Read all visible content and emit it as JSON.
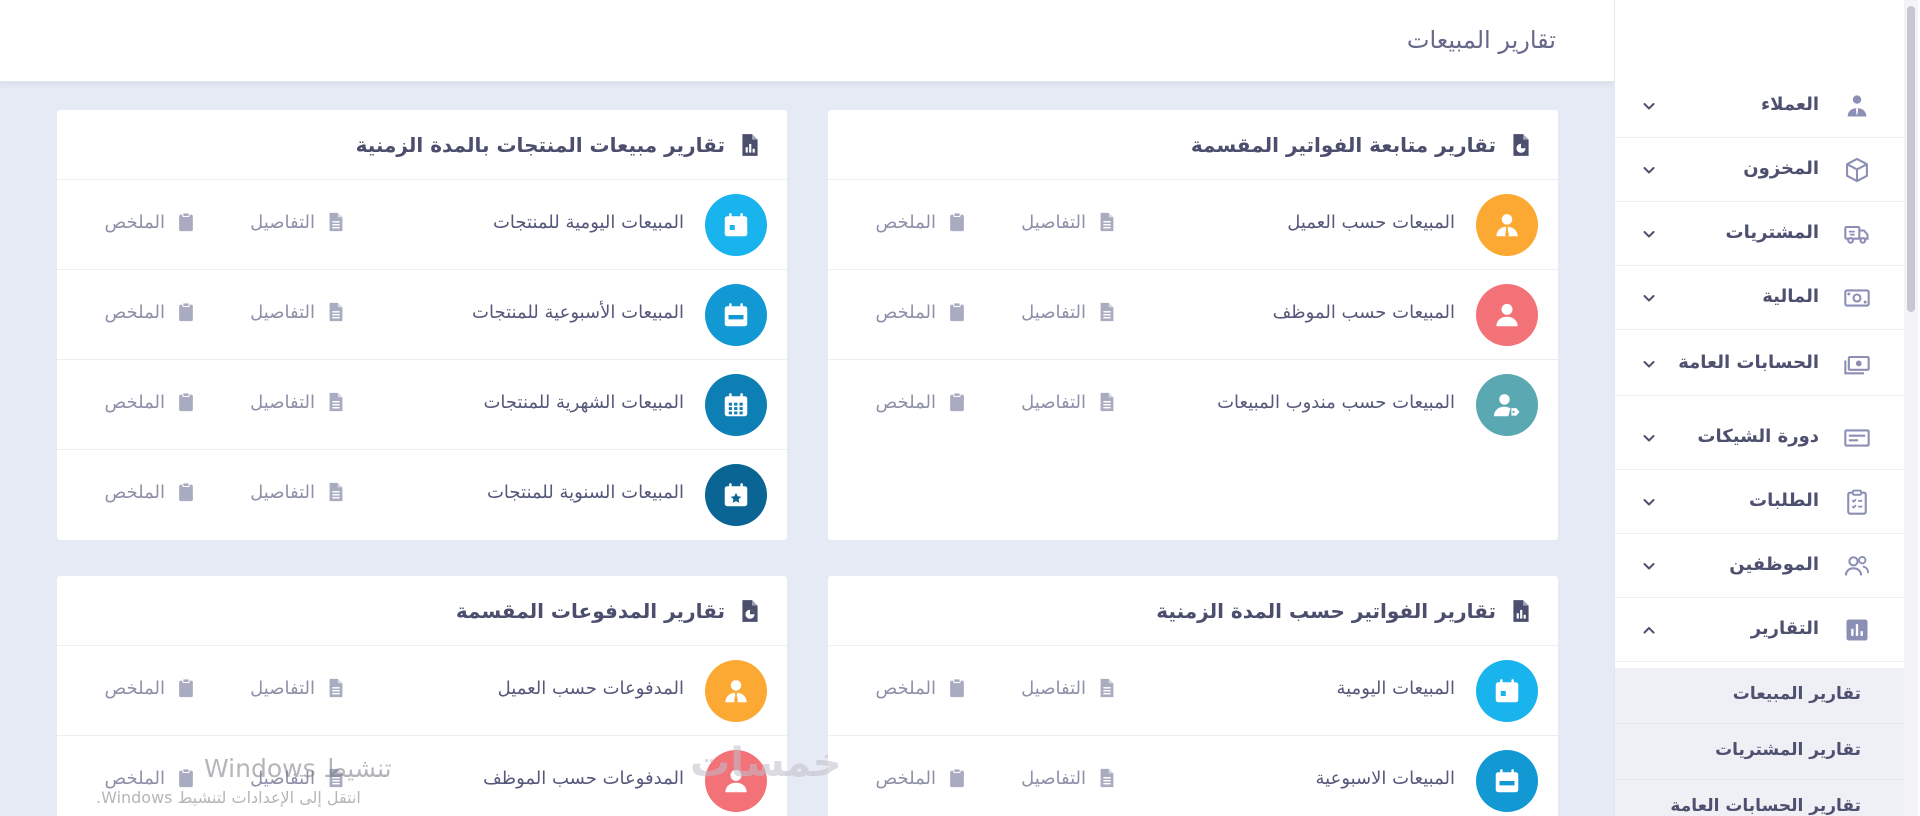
{
  "page_title": "تقارير المبيعات",
  "cards": [
    {
      "title": "تقارير متابعة الفواتير المقسمة",
      "header_icon": "file-pie-icon",
      "rows": [
        {
          "label": "المبيعات حسب العميل",
          "icon": "user-tie-icon",
          "color": "#fba933"
        },
        {
          "label": "المبيعات حسب الموظف",
          "icon": "user-icon",
          "color": "#f37278"
        },
        {
          "label": "المبيعات حسب مندوب المبيعات",
          "icon": "user-tag-icon",
          "color": "#5aa8b2"
        }
      ]
    },
    {
      "title": "تقارير مبيعات المنتجات بالمدة الزمنية",
      "header_icon": "file-chart-icon",
      "rows": [
        {
          "label": "المبيعات اليومية للمنتجات",
          "icon": "calendar-day-icon",
          "color": "#19b3ee"
        },
        {
          "label": "المبيعات الأسبوعية للمنتجات",
          "icon": "calendar-week-icon",
          "color": "#1299d4"
        },
        {
          "label": "المبيعات الشهرية للمنتجات",
          "icon": "calendar-month-icon",
          "color": "#0d7fb4"
        },
        {
          "label": "المبيعات السنوية للمنتجات",
          "icon": "calendar-star-icon",
          "color": "#0b6594"
        }
      ]
    },
    {
      "title": "تقارير الفواتير حسب المدة الزمنية",
      "header_icon": "file-chart-icon",
      "rows": [
        {
          "label": "المبيعات اليومية",
          "icon": "calendar-day-icon",
          "color": "#19b3ee"
        },
        {
          "label": "المبيعات الاسبوعية",
          "icon": "calendar-week-icon",
          "color": "#1299d4"
        }
      ]
    },
    {
      "title": "تقارير المدفوعات المقسمة",
      "header_icon": "file-pie-icon",
      "rows": [
        {
          "label": "المدفوعات حسب العميل",
          "icon": "user-tie-icon",
          "color": "#fba933"
        },
        {
          "label": "المدفوعات حسب الموظف",
          "icon": "user-icon",
          "color": "#f37278"
        }
      ]
    }
  ],
  "row_links": {
    "details": "التفاصيل",
    "summary": "الملخص"
  },
  "sidebar": {
    "items": [
      {
        "label": "العملاء",
        "icon": "customers-icon",
        "expanded": false
      },
      {
        "label": "المخزون",
        "icon": "box-icon",
        "expanded": false
      },
      {
        "label": "المشتريات",
        "icon": "truck-icon",
        "expanded": false
      },
      {
        "label": "المالية",
        "icon": "money-icon",
        "expanded": false
      },
      {
        "label": "الحسابات العامة",
        "icon": "cash-icon",
        "expanded": false
      },
      {
        "label": "دورة الشيكات",
        "icon": "cheque-icon",
        "expanded": false
      },
      {
        "label": "الطلبات",
        "icon": "clipboard-icon",
        "expanded": false
      },
      {
        "label": "الموظفين",
        "icon": "users-icon",
        "expanded": false
      },
      {
        "label": "التقارير",
        "icon": "chart-icon",
        "expanded": true
      }
    ],
    "sub_items": [
      "تقارير المبيعات",
      "تقارير المشتريات",
      "تقارير الحسابات العامة"
    ]
  },
  "watermarks": {
    "activate_title": "تنشيط Windows",
    "activate_hint": "انتقل إلى الإعدادات لتنشيط Windows.",
    "logo_text": "خمسات"
  },
  "colors": {
    "accent": "#5b5e94",
    "link": "#8d90a8",
    "background": "#e6eaf4"
  }
}
